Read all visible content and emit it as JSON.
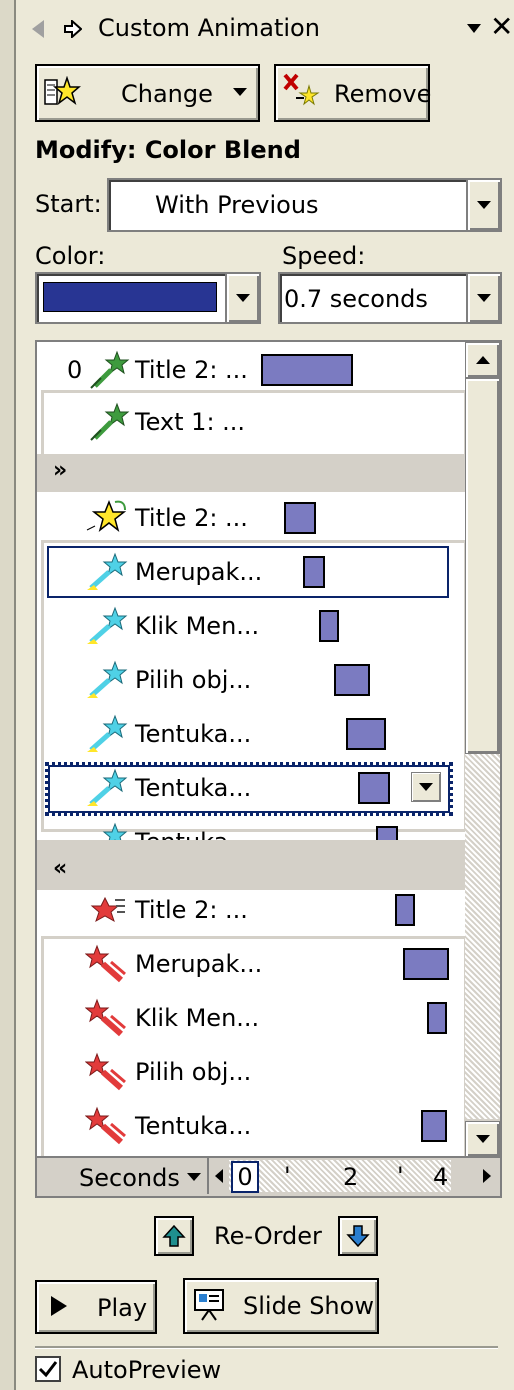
{
  "panel": {
    "title": "Custom Animation",
    "change_label": "Change",
    "remove_label": "Remove",
    "modify_heading": "Modify: Color Blend",
    "start_label": "Start:",
    "start_value": "With Previous",
    "color_label": "Color:",
    "color_swatch": "#283593",
    "speed_label": "Speed:",
    "speed_value": "0.7 seconds"
  },
  "list": {
    "row0_number": "0",
    "items": [
      {
        "label": "Title 2: ...",
        "icon": "emphasis-star-green-icon"
      },
      {
        "label": "Text 1: ...",
        "icon": "emphasis-star-green-icon"
      },
      {
        "label": "Title 2: ...",
        "icon": "entrance-star-yellow-icon"
      },
      {
        "label": "Merupak...",
        "icon": "emphasis-star-cyan-icon"
      },
      {
        "label": "Klik Men...",
        "icon": "emphasis-star-cyan-icon"
      },
      {
        "label": "Pilih obj...",
        "icon": "emphasis-star-cyan-icon"
      },
      {
        "label": "Tentuka...",
        "icon": "emphasis-star-cyan-icon"
      },
      {
        "label": "Tentuka...",
        "icon": "emphasis-star-cyan-icon"
      },
      {
        "label": "Tentuka...",
        "icon": "emphasis-star-cyan-icon"
      },
      {
        "label": "Title 2: ...",
        "icon": "exit-star-red-icon"
      },
      {
        "label": "Merupak...",
        "icon": "exit-star-red-icon"
      },
      {
        "label": "Klik Men...",
        "icon": "exit-star-red-icon"
      },
      {
        "label": "Pilih obj...",
        "icon": "exit-star-red-icon"
      },
      {
        "label": "Tentuka...",
        "icon": "exit-star-red-icon"
      }
    ]
  },
  "timeline": {
    "unit_label": "Seconds",
    "ticks": [
      "0",
      "2",
      "4"
    ]
  },
  "reorder_label": "Re-Order",
  "play_label": "Play",
  "slideshow_label": "Slide Show",
  "autopreview_label": "AutoPreview",
  "autopreview_checked": true,
  "colors": {
    "bar": "#7b7bc1",
    "selected_border": "#0a246a"
  }
}
